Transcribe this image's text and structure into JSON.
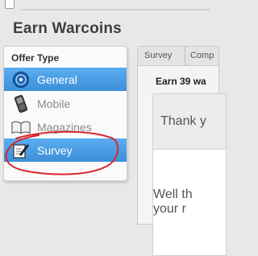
{
  "page": {
    "title": "Earn Warcoins"
  },
  "sidebar": {
    "header": "Offer Type",
    "items": [
      {
        "label": "General",
        "icon": "globe-icon",
        "active": true
      },
      {
        "label": "Mobile",
        "icon": "mobile-phone-icon",
        "active": false
      },
      {
        "label": "Magazines",
        "icon": "open-book-icon",
        "active": false
      },
      {
        "label": "Survey",
        "icon": "survey-pen-icon",
        "active": true
      }
    ]
  },
  "content": {
    "tabs": [
      "Survey",
      "Comp"
    ],
    "earn_title": "Earn 39 wa",
    "thank_text": "Thank y",
    "body_line1": "Well th",
    "body_line2": "your r"
  },
  "colors": {
    "active": "#3d8ed8",
    "annotation": "#d9262c"
  }
}
